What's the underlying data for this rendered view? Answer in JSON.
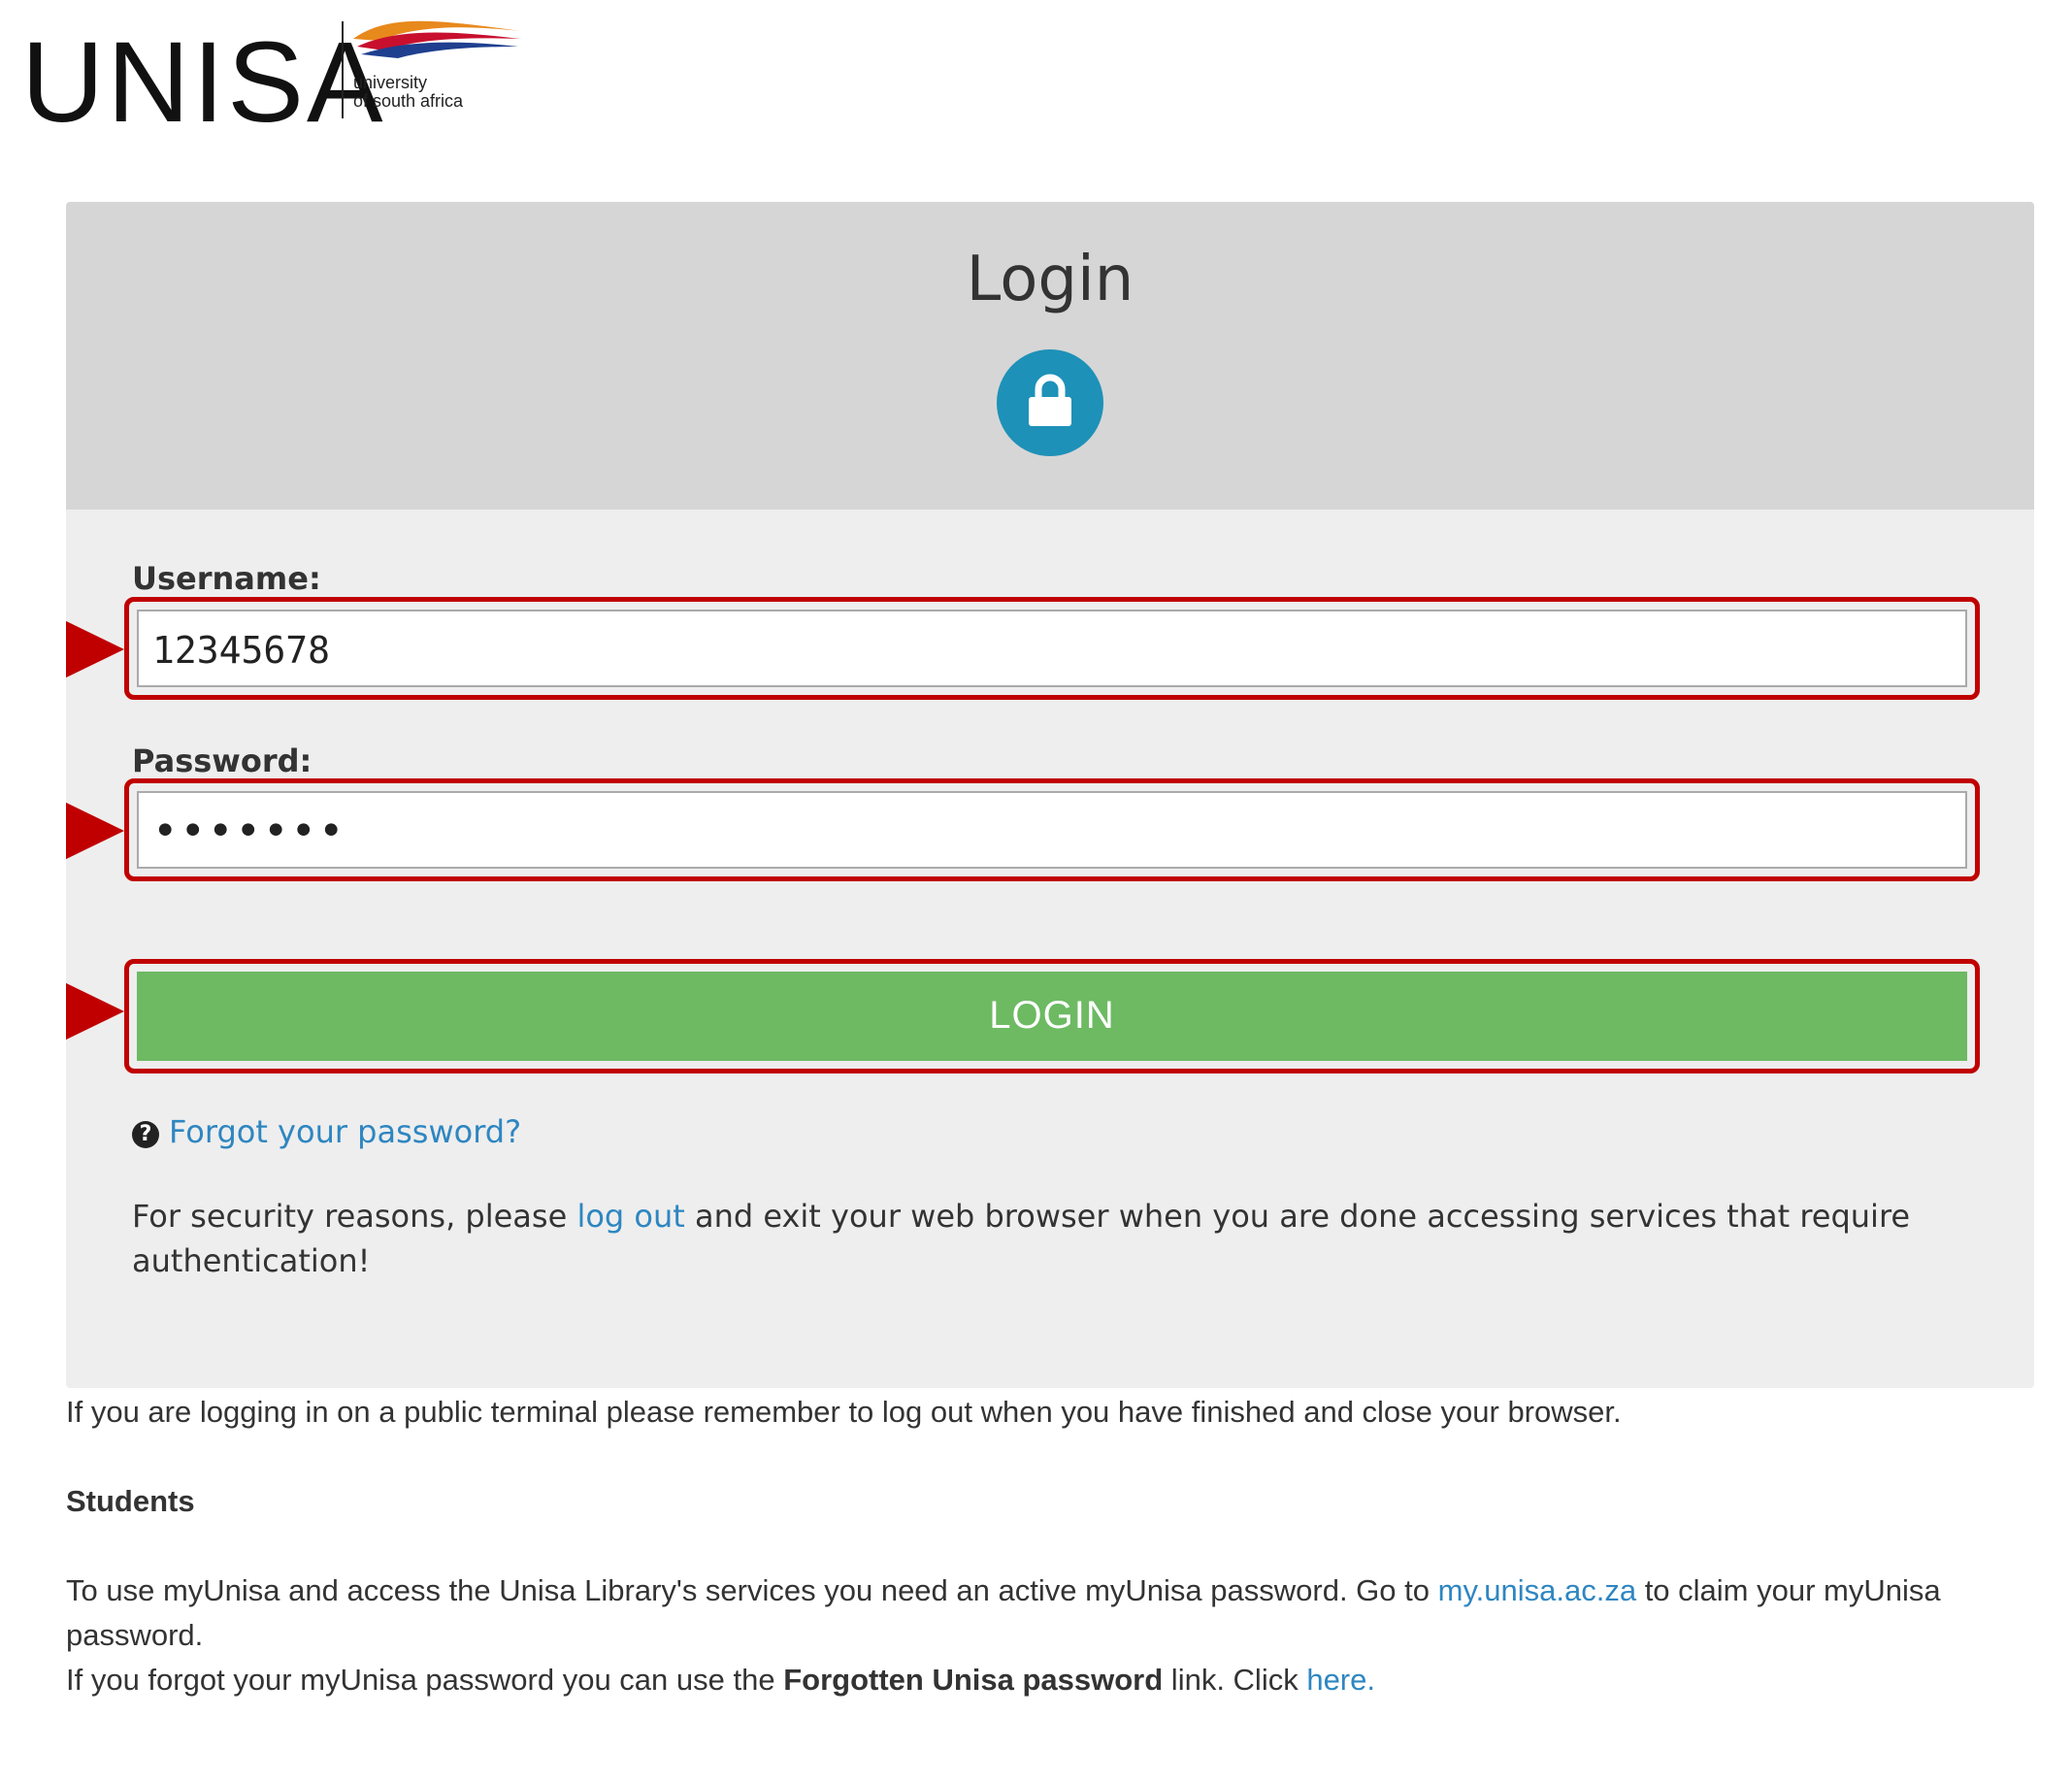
{
  "logo": {
    "wordmark": "UNISA",
    "subtitle_line1": "university",
    "subtitle_line2": "of south africa"
  },
  "login": {
    "title": "Login",
    "lock_icon": "lock-icon",
    "username_label": "Username:",
    "username_value": "12345678",
    "password_label": "Password:",
    "password_value": "•••••••",
    "submit_label": "LOGIN",
    "forgot_link": "Forgot your password?",
    "security_text_before": "For security reasons, please ",
    "security_link": "log out",
    "security_text_after": " and exit your web browser when you are done accessing services that require authentication!"
  },
  "notice": {
    "public_terminal": "If you are logging in on a public terminal please remember to log out when you have finished and close your browser.",
    "students_heading": "Students",
    "para1_before": "To use myUnisa and access the Unisa Library's services you need an active myUnisa password. Go to ",
    "para1_link": "my.unisa.ac.za",
    "para1_after": " to claim your myUnisa password.",
    "para2_before": "If you forgot your myUnisa password you can use the ",
    "para2_bold": "Forgotten Unisa password",
    "para2_mid": " link. Click ",
    "para2_link": "here",
    "para2_after": "."
  },
  "colors": {
    "highlight": "#c00000",
    "login_button": "#6dba63",
    "lock_circle": "#1e91b8",
    "link": "#2e86c1"
  }
}
